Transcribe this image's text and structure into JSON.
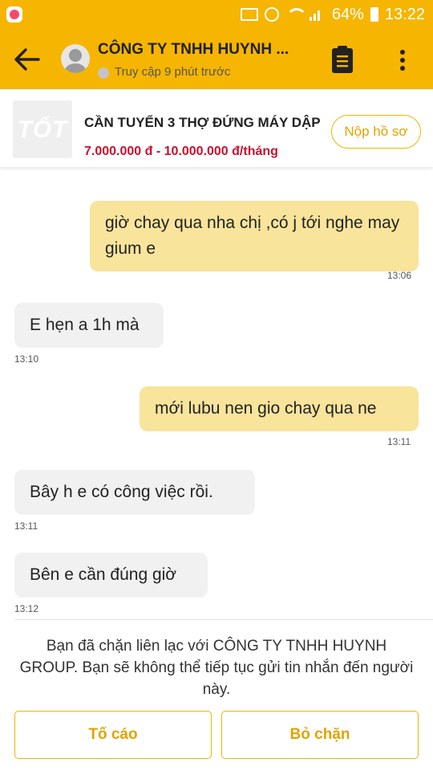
{
  "status_bar": {
    "battery": "64%",
    "time": "13:22"
  },
  "header": {
    "company_name": "CÔNG TY TNHH HUYNH ...",
    "presence": "Truy cập 9 phút trước",
    "back_icon": "arrow-left-icon",
    "notes_icon": "clipboard-icon",
    "more_icon": "more-vertical-icon",
    "accent_color": "#f6b500"
  },
  "job": {
    "logo_text": "TỐT",
    "title": "CẦN TUYỂN 3 THỢ ĐỨNG MÁY DẬP",
    "salary": "7.000.000 đ - 10.000.000 đ/tháng",
    "apply_label": "Nộp hồ sơ",
    "salary_color": "#c8102e"
  },
  "messages": [
    {
      "side": "sent",
      "text": "giờ chay qua nha chị ,có j tới nghe may gium e",
      "time": "13:06"
    },
    {
      "side": "received",
      "text": "E hẹn a 1h mà",
      "time": "13:10"
    },
    {
      "side": "sent",
      "text": "mới lubu nen gio chay qua ne",
      "time": "13:11"
    },
    {
      "side": "received",
      "text": "Bây h e có công việc rồi.",
      "time": "13:11"
    },
    {
      "side": "received",
      "text": "Bên e cần đúng giờ",
      "time": "13:12"
    }
  ],
  "footer": {
    "blocked_notice": "Bạn đã chặn liên lạc với CÔNG TY TNHH HUYNH GROUP. Bạn sẽ không thể tiếp tục gửi tin nhắn đến người này.",
    "report_label": "Tố cáo",
    "unblock_label": "Bỏ chặn"
  }
}
